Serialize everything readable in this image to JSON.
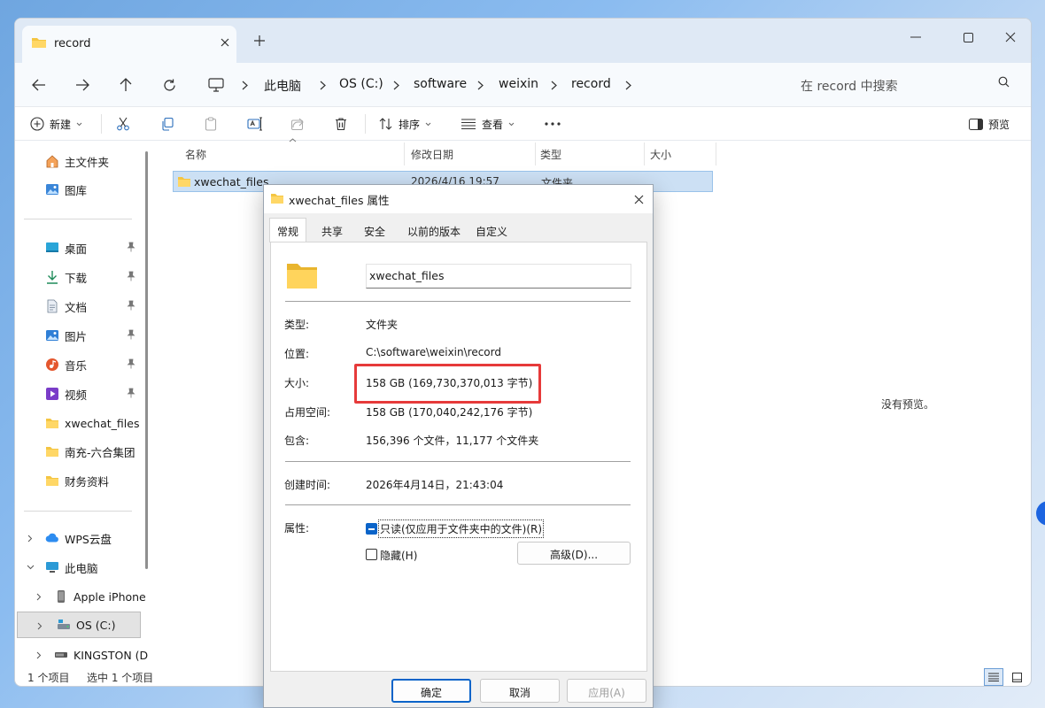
{
  "window": {
    "tab_title": "record",
    "breadcrumb": [
      "此电脑",
      "OS (C:)",
      "software",
      "weixin",
      "record"
    ],
    "search_placeholder": "在 record 中搜索"
  },
  "toolbar": {
    "new_label": "新建",
    "sort_label": "排序",
    "view_label": "查看",
    "preview_label": "预览"
  },
  "sidebar": {
    "top": [
      {
        "label": "主文件夹",
        "icon": "home-icon"
      },
      {
        "label": "图库",
        "icon": "gallery-icon"
      }
    ],
    "pinned": [
      {
        "label": "桌面",
        "icon": "desktop-icon"
      },
      {
        "label": "下载",
        "icon": "download-icon"
      },
      {
        "label": "文档",
        "icon": "document-icon"
      },
      {
        "label": "图片",
        "icon": "pictures-icon"
      },
      {
        "label": "音乐",
        "icon": "music-icon"
      },
      {
        "label": "视频",
        "icon": "video-icon"
      },
      {
        "label": "xwechat_files",
        "icon": "folder-icon"
      },
      {
        "label": "南充-六合集团",
        "icon": "folder-icon"
      },
      {
        "label": "财务资料",
        "icon": "folder-icon"
      }
    ],
    "tree": [
      {
        "label": "WPS云盘",
        "icon": "cloud-icon"
      },
      {
        "label": "此电脑",
        "icon": "computer-icon"
      },
      {
        "label": "Apple iPhone",
        "icon": "phone-icon"
      },
      {
        "label": "OS (C:)",
        "icon": "drive-icon"
      },
      {
        "label": "KINGSTON (D",
        "icon": "usb-drive-icon"
      }
    ]
  },
  "filelist": {
    "columns": [
      "名称",
      "修改日期",
      "类型",
      "大小"
    ],
    "rows": [
      {
        "name": "xwechat_files",
        "date": "2026/4/16 19:57",
        "type": "文件夹"
      }
    ]
  },
  "preview_empty": "没有预览。",
  "status": {
    "count": "1 个项目",
    "selected": "选中 1 个项目"
  },
  "dialog": {
    "title": "xwechat_files 属性",
    "tabs": [
      "常规",
      "共享",
      "安全",
      "以前的版本",
      "自定义"
    ],
    "name": "xwechat_files",
    "labels": {
      "type": "类型:",
      "location": "位置:",
      "size": "大小:",
      "size_on_disk": "占用空间:",
      "contains": "包含:",
      "created": "创建时间:",
      "attributes": "属性:"
    },
    "values": {
      "type": "文件夹",
      "location": "C:\\software\\weixin\\record",
      "size": "158 GB (169,730,370,013 字节)",
      "size_on_disk": "158 GB (170,040,242,176 字节)",
      "contains": "156,396 个文件，11,177 个文件夹",
      "created": "2026年4月14日，21:43:04"
    },
    "readonly_label": "只读(仅应用于文件夹中的文件)(R)",
    "hidden_label": "隐藏(H)",
    "advanced_label": "高级(D)...",
    "ok_label": "确定",
    "cancel_label": "取消",
    "apply_label": "应用(A)"
  }
}
